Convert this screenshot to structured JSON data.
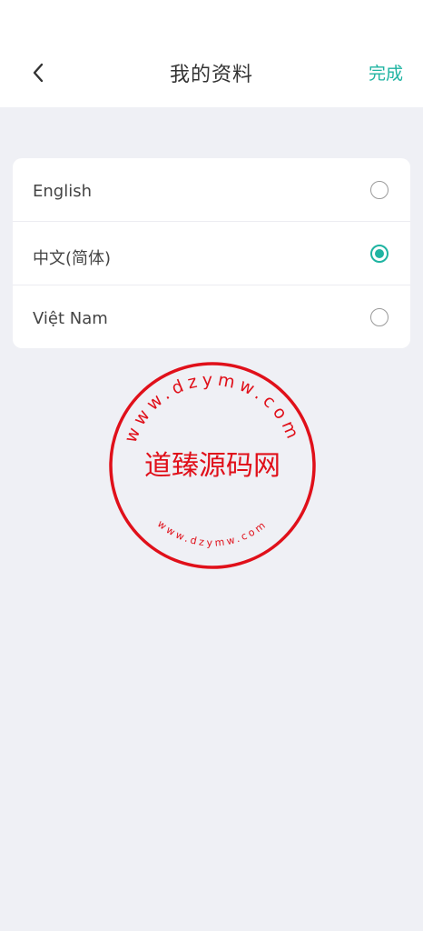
{
  "header": {
    "back_icon": "chevron-left-icon",
    "title": "我的资料",
    "done_label": "完成"
  },
  "languages": [
    {
      "label": "English",
      "selected": false
    },
    {
      "label": "中文(简体)",
      "selected": true
    },
    {
      "label": "Việt Nam",
      "selected": false
    }
  ],
  "watermark": {
    "top_arc": "www.dzymw.com",
    "center": "道臻源码网",
    "bottom_arc": "www.dzymw.com"
  },
  "colors": {
    "accent": "#1fb4a2",
    "background": "#eff0f5",
    "stamp": "#e0101a"
  }
}
